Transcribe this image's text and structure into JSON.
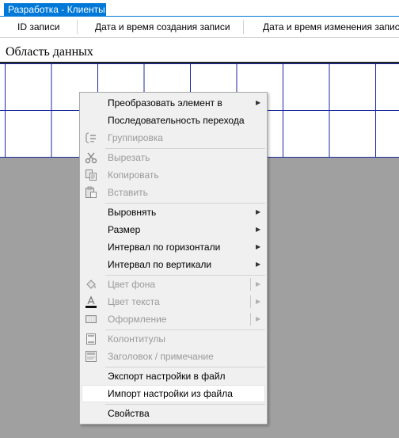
{
  "window": {
    "title": "Разработка - Клиенты"
  },
  "columns": [
    {
      "label": "ID записи"
    },
    {
      "label": "Дата и время создания записи"
    },
    {
      "label": "Дата и время изменения записи"
    }
  ],
  "data_area": {
    "label": "Область данных"
  },
  "context_menu": {
    "items": [
      {
        "label": "Преобразовать элемент в",
        "enabled": true,
        "submenu": true
      },
      {
        "label": "Последовательность перехода",
        "enabled": true,
        "submenu": false
      },
      {
        "label": "Группировка",
        "enabled": false,
        "icon": "grouping-icon"
      },
      {
        "label": "Вырезать",
        "enabled": false,
        "icon": "scissors-icon"
      },
      {
        "label": "Копировать",
        "enabled": false,
        "icon": "copy-icon"
      },
      {
        "label": "Вставить",
        "enabled": false,
        "icon": "paste-icon"
      },
      {
        "label": "Выровнять",
        "enabled": true,
        "submenu": true
      },
      {
        "label": "Размер",
        "enabled": true,
        "submenu": true
      },
      {
        "label": "Интервал по горизонтали",
        "enabled": true,
        "submenu": true
      },
      {
        "label": "Интервал по вертикали",
        "enabled": true,
        "submenu": true
      },
      {
        "label": "Цвет фона",
        "enabled": false,
        "submenu": true,
        "icon": "fill-color-icon"
      },
      {
        "label": "Цвет текста",
        "enabled": false,
        "submenu": true,
        "icon": "text-color-icon"
      },
      {
        "label": "Оформление",
        "enabled": false,
        "submenu": true,
        "icon": "border-style-icon"
      },
      {
        "label": "Колонтитулы",
        "enabled": false,
        "icon": "header-footer-icon"
      },
      {
        "label": "Заголовок / примечание",
        "enabled": false,
        "icon": "title-note-icon"
      },
      {
        "label": "Экспорт настройки в файл",
        "enabled": true
      },
      {
        "label": "Импорт настройки из файла",
        "enabled": true,
        "highlighted": true
      },
      {
        "label": "Свойства",
        "enabled": true
      }
    ]
  }
}
